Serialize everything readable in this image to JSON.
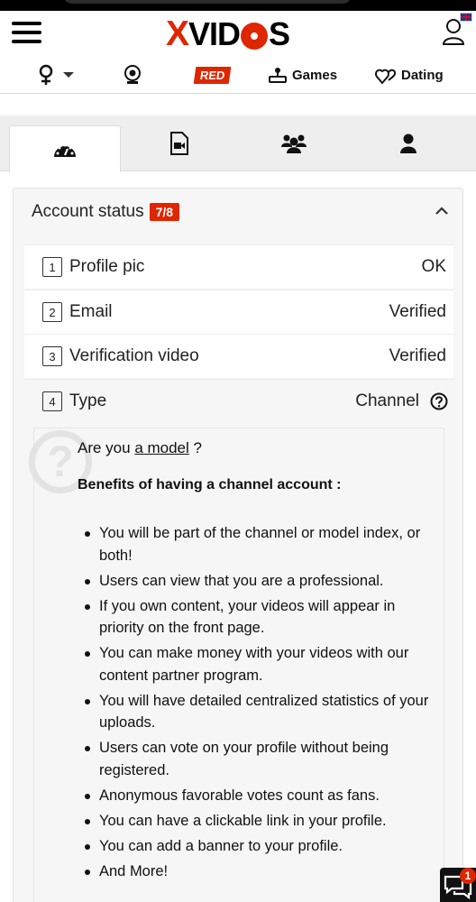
{
  "header": {
    "logo": {
      "x": "X",
      "rest_a": "VID",
      "rest_b": "S"
    }
  },
  "nav": {
    "red_label": "RED",
    "games_label": "Games",
    "dating_label": "Dating"
  },
  "account_status": {
    "title": "Account status",
    "badge": "7/8",
    "rows": [
      {
        "num": "1",
        "label": "Profile pic",
        "value": "OK"
      },
      {
        "num": "2",
        "label": "Email",
        "value": "Verified"
      },
      {
        "num": "3",
        "label": "Verification video",
        "value": "Verified"
      },
      {
        "num": "4",
        "label": "Type",
        "value": "Channel"
      }
    ]
  },
  "info": {
    "ask_prefix": "Are you ",
    "ask_link": "a model",
    "ask_suffix": " ?",
    "benefits_title": "Benefits of having a channel account :",
    "benefits": [
      "You will be part of the channel or model index, or both!",
      "Users can view that you are a professional.",
      "If you own content, your videos will appear in priority on the front page.",
      "You can make money with your videos with our content partner program.",
      "You will have detailed centralized statistics of your uploads.",
      "Users can vote on your profile without being registered.",
      "Anonymous favorable votes count as fans.",
      "You can have a clickable link in your profile.",
      "You can add a banner to your profile.",
      "And More!"
    ]
  },
  "chat": {
    "count": "1"
  },
  "colors": {
    "brand_red": "#de2600"
  }
}
